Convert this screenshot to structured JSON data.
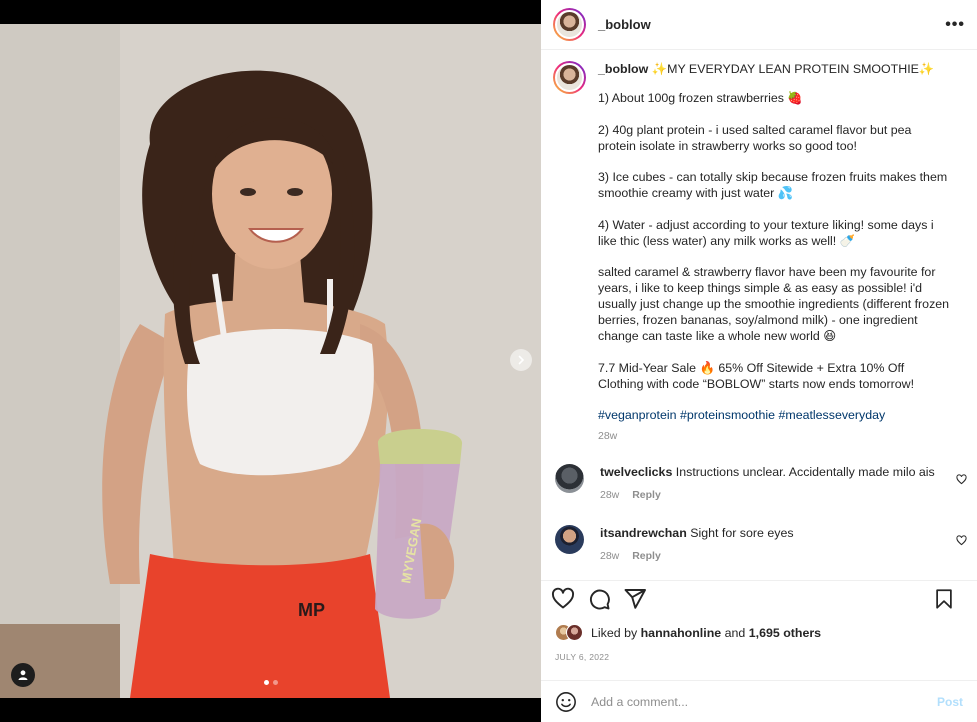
{
  "post": {
    "username": "_boblow",
    "more_label": "•••"
  },
  "caption": {
    "username": "_boblow",
    "title": "✨MY EVERYDAY LEAN PROTEIN SMOOTHIE✨",
    "paragraphs": [
      "1) About 100g frozen strawberries 🍓",
      "2) 40g plant protein - i used salted caramel flavor but pea protein isolate in strawberry works so good too!",
      "3) Ice cubes - can totally skip because frozen fruits makes them smoothie creamy with just water 💦",
      "4) Water - adjust according to your texture liking! some days i like thic (less water) any milk works as well! 🍼",
      "salted caramel & strawberry flavor have been my favourite for years, i like to keep things simple & as easy as possible! i'd usually just change up the smoothie ingredients (different frozen berries, frozen bananas, soy/almond milk) - one ingredient change can taste like a whole new world 😆",
      "7.7 Mid-Year Sale 🔥 65% Off Sitewide + Extra 10% Off Clothing with code “BOBLOW” starts now ends tomorrow!"
    ],
    "hashtags": "#veganprotein #proteinsmoothie #meatlesseveryday",
    "time": "28w"
  },
  "comments": [
    {
      "username": "twelveclicks",
      "text": "Instructions unclear. Accidentally made milo ais",
      "time": "28w",
      "reply": "Reply"
    },
    {
      "username": "itsandrewchan",
      "text": "Sight for sore eyes",
      "time": "28w",
      "reply": "Reply"
    }
  ],
  "likes": {
    "prefix": "Liked by",
    "user": "hannahonline",
    "and": "and",
    "others": "1,695 others"
  },
  "date": "JULY 6, 2022",
  "add_comment": {
    "placeholder": "Add a comment...",
    "post_label": "Post"
  },
  "carousel": {
    "count": 2,
    "active_index": 0
  },
  "colors": {
    "link": "#00376b",
    "muted": "#8e8e8e",
    "post_disabled": "#b2dffc",
    "text": "#262626"
  },
  "icons": [
    "heart-icon",
    "comment-icon",
    "share-icon",
    "bookmark-icon",
    "emoji-icon",
    "chevron-right-icon",
    "user-tag-icon",
    "more-icon"
  ]
}
